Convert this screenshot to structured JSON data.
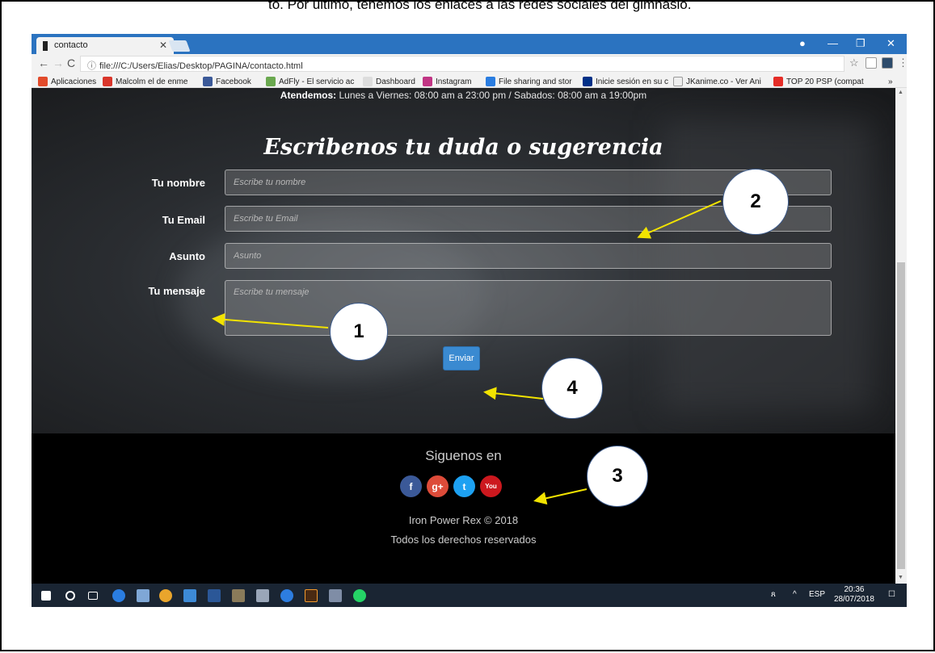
{
  "top_note": "to. Por último, tenemos los enlaces a las redes sociales del gimnasio.",
  "browser": {
    "tab_title": "contacto",
    "url": "file:///C:/Users/Elias/Desktop/PAGINA/contacto.html",
    "bookmarks": [
      {
        "label": "Aplicaciones",
        "icon": "apps-icon",
        "color": "#e24b2b"
      },
      {
        "label": "Malcolm el de enme",
        "icon": "k-icon",
        "color": "#d9362b"
      },
      {
        "label": "Facebook",
        "icon": "facebook-icon",
        "color": "#3b5998"
      },
      {
        "label": "AdFly - El servicio ac",
        "icon": "adfly-icon",
        "color": "#6aa84f"
      },
      {
        "label": "Dashboard",
        "icon": "page-icon",
        "color": "#dddddd"
      },
      {
        "label": "Instagram",
        "icon": "instagram-icon",
        "color": "#c13584"
      },
      {
        "label": "File sharing and stor",
        "icon": "share-icon",
        "color": "#2a7de1"
      },
      {
        "label": "Inicie sesión en su c",
        "icon": "paypal-icon",
        "color": "#003087"
      },
      {
        "label": "JKanime.co - Ver Ani",
        "icon": "page-icon",
        "color": "#eeeeee"
      },
      {
        "label": "TOP 20 PSP (compat",
        "icon": "youtube-icon",
        "color": "#e52d27"
      }
    ],
    "more": "»"
  },
  "page": {
    "hours_label": "Atendemos:",
    "hours_text": " Lunes a Viernes: 08:00 am a 23:00 pm / Sabados: 08:00 am a 19:00pm",
    "form_title": "Escribenos tu duda o sugerencia",
    "fields": {
      "name": {
        "label": "Tu nombre",
        "placeholder": "Escribe tu nombre"
      },
      "email": {
        "label": "Tu Email",
        "placeholder": "Escribe tu Email"
      },
      "subject": {
        "label": "Asunto",
        "placeholder": "Asunto"
      },
      "message": {
        "label": "Tu mensaje",
        "placeholder": "Escribe tu mensaje"
      }
    },
    "send_label": "Enviar"
  },
  "footer": {
    "follow": "Siguenos en",
    "socials": [
      {
        "name": "facebook-icon",
        "glyph": "f",
        "color": "#3b5998"
      },
      {
        "name": "google-plus-icon",
        "glyph": "g+",
        "color": "#dd4b39"
      },
      {
        "name": "twitter-icon",
        "glyph": "t",
        "color": "#1da1f2"
      },
      {
        "name": "youtube-icon",
        "glyph": "You",
        "color": "#cc181e"
      }
    ],
    "copyright": "Iron Power Rex © 2018",
    "rights": "Todos los derechos reservados"
  },
  "taskbar": {
    "lang": "ESP",
    "time": "20:36",
    "date": "28/07/2018"
  },
  "callouts": [
    "1",
    "2",
    "3",
    "4"
  ]
}
